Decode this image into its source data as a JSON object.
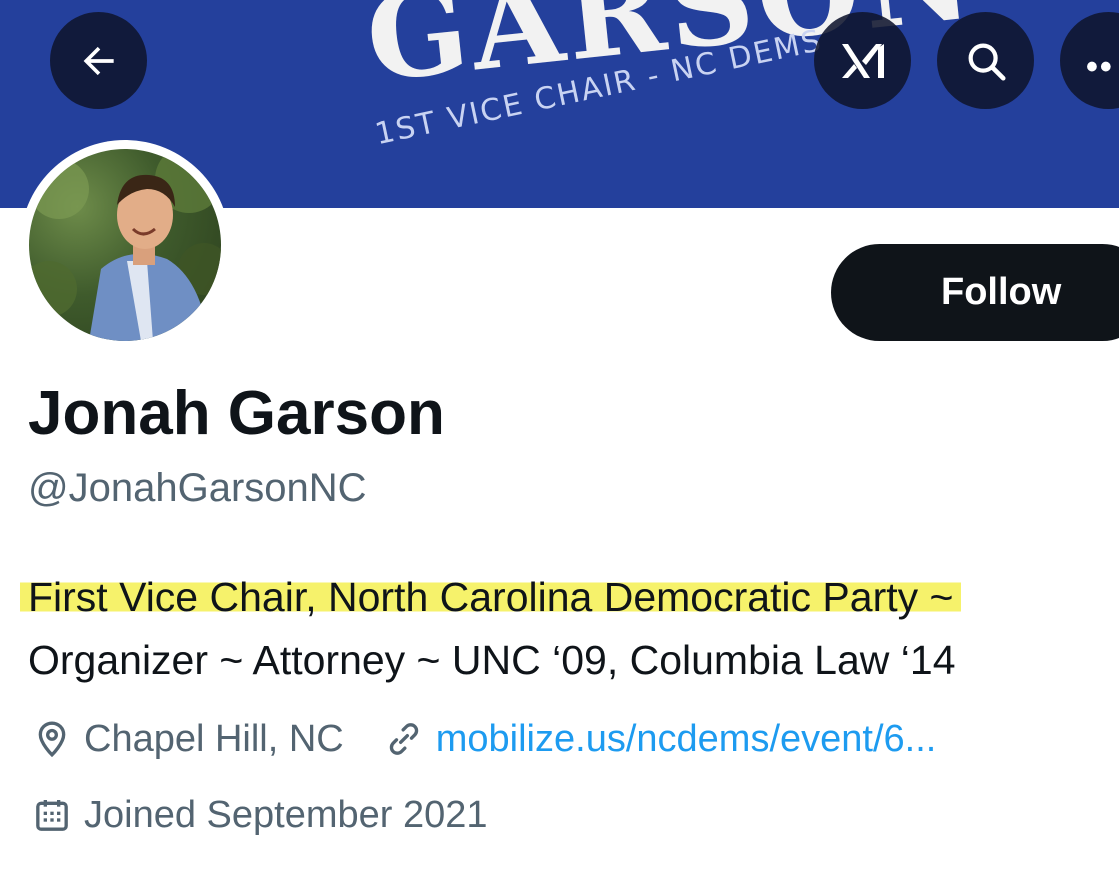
{
  "banner": {
    "headline": "GARSON",
    "subline": "1ST VICE CHAIR - NC DEMS",
    "color": "#24409c"
  },
  "nav": {
    "back_icon": "back-arrow-icon",
    "grok_icon": "grok-icon",
    "search_icon": "search-icon",
    "more_icon": "more-icon"
  },
  "profile": {
    "display_name": "Jonah Garson",
    "handle": "@JonahGarsonNC",
    "bio_line1": "First Vice Chair, North Carolina Democratic Party ~",
    "bio_line2": "Organizer ~ Attorney ~ UNC ‘09, Columbia Law ‘14",
    "location": "Chapel Hill, NC",
    "website": "mobilize.us/ncdems/event/6...",
    "joined": "Joined September 2021"
  },
  "actions": {
    "follow_label": "Follow"
  },
  "colors": {
    "link": "#1d9bf0",
    "secondary_text": "#536471",
    "highlight": "#f6f26b"
  }
}
